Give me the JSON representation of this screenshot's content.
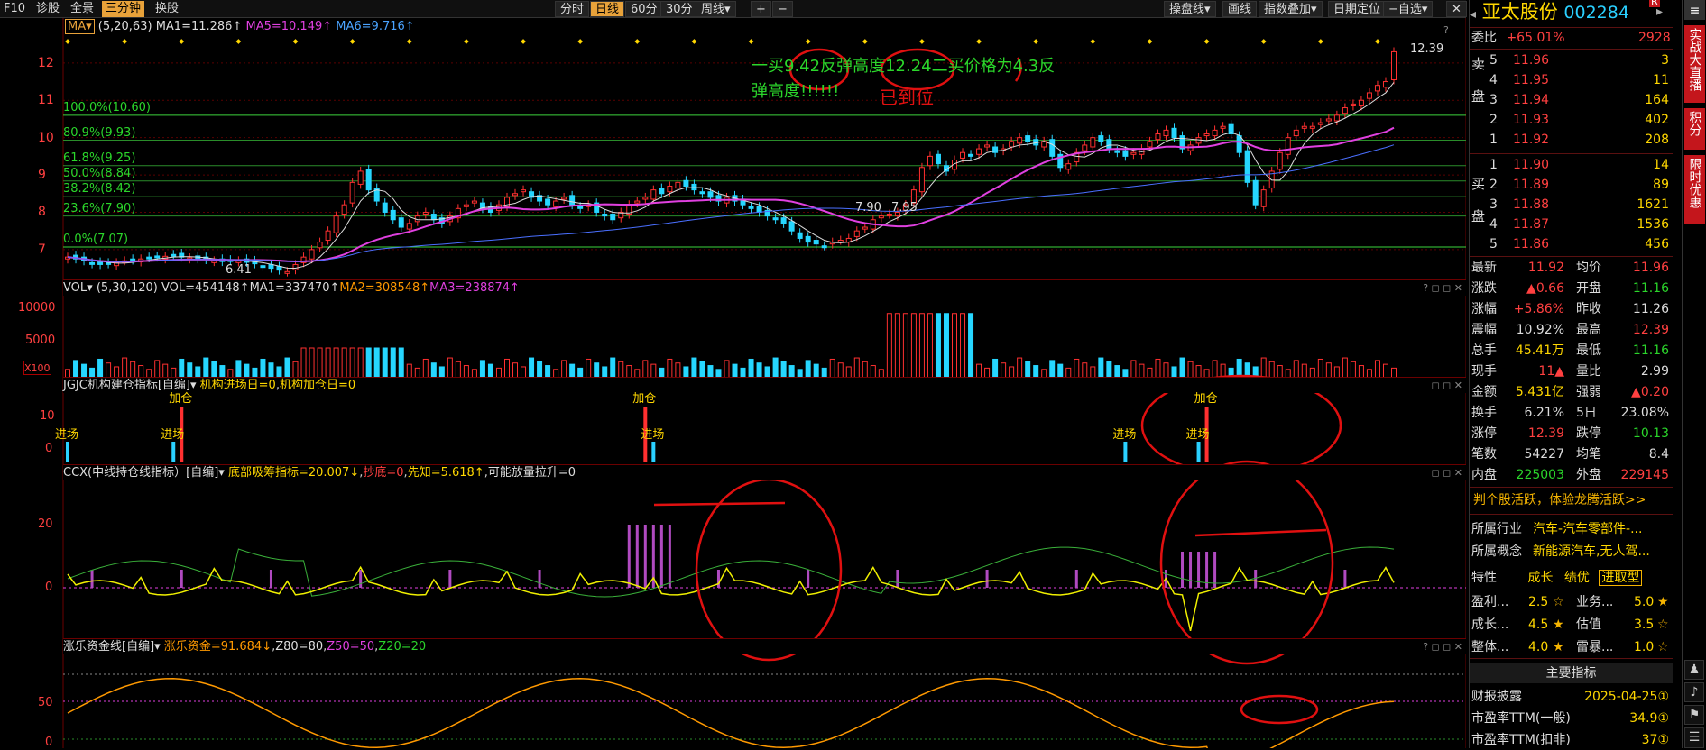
{
  "toolbar": {
    "f10": "F10",
    "diagnose": "诊股",
    "fullview": "全景",
    "three_min": "三分钟",
    "switch_stock": "换股",
    "periods": [
      "分时",
      "日线",
      "60分",
      "30分",
      "周线▾"
    ],
    "active_period": "日线",
    "plus": "+",
    "minus": "−",
    "ops": "操盘线▾",
    "draw": "画线",
    "overlay": "指数叠加▾",
    "date_locate": "日期定位",
    "watchlist": "−自选▾",
    "close": "✕"
  },
  "main_chart": {
    "ma_legend_type": "MA▾",
    "ma_params": "(5,20,63)",
    "ma1": "MA1=11.286↑",
    "ma5": "MA5=10.149↑",
    "ma6": "MA6=9.716↑",
    "fib": [
      "100.0%(10.60)",
      "80.9%(9.93)",
      "61.8%(9.25)",
      "50.0%(8.84)",
      "38.2%(8.42)",
      "23.6%(7.90)",
      "0.0%(7.07)"
    ],
    "y_ticks": [
      "12",
      "11",
      "10",
      "9",
      "8",
      "7"
    ],
    "low_label": "6.41",
    "high_label": "12.39",
    "mid_labels": [
      "7.90",
      "7.95"
    ],
    "annotation_line1": "一买9.42反弹高度12.24二买价格为4.3反",
    "annotation_line2": "弹高度!!!!!!",
    "annotation_red": "已到位",
    "question_mark": "?"
  },
  "vol_panel": {
    "label": "VOL▾",
    "params": "(5,30,120)",
    "vol": "VOL=454148↑",
    "ma1": "MA1=337470↑",
    "ma2": "MA2=308548↑",
    "ma3": "MA3=238874↑",
    "y_ticks": [
      "10000",
      "5000"
    ],
    "unit": "X100",
    "controls": "? ◻ ◻ ✕"
  },
  "jgjc_panel": {
    "label": "JGJC机构建仓指标[自编]▾",
    "value1": "机构进场日=0",
    "value2": "机构加仓日=0",
    "y_ticks": [
      "10",
      "0"
    ],
    "signals": [
      "进场",
      "进场",
      "加仓",
      "加仓",
      "进场",
      "进场",
      "进场",
      "加仓"
    ],
    "controls": "◻ ◻ ✕"
  },
  "ccx_panel": {
    "label": "CCX(中线持仓线指标）[自编]▾",
    "v1": "底部吸筹指标=20.007↓",
    "v2": "抄底=0",
    "v3": "先知=5.618↑",
    "v4": "可能放量拉升=0",
    "y_ticks": [
      "20",
      "0"
    ],
    "controls": "◻ ◻ ✕"
  },
  "zl_panel": {
    "label": "涨乐资金线[自编]▾",
    "v1": "涨乐资金=91.684↓",
    "v2": "Z80=80",
    "v3": "Z50=50",
    "v4": "Z20=20",
    "y_ticks": [
      "50",
      "0"
    ],
    "controls": "? ◻ ◻ ✕"
  },
  "chart_data": {
    "type": "candlestick",
    "ylim": [
      6.2,
      12.6
    ],
    "closes": [
      6.8,
      6.75,
      6.7,
      6.62,
      6.6,
      6.62,
      6.65,
      6.7,
      6.72,
      6.75,
      6.78,
      6.8,
      6.82,
      6.85,
      6.8,
      6.78,
      6.75,
      6.73,
      6.7,
      6.68,
      6.72,
      6.7,
      6.66,
      6.62,
      6.55,
      6.5,
      6.45,
      6.41,
      6.6,
      6.8,
      7.0,
      7.2,
      7.5,
      7.9,
      8.2,
      8.8,
      9.1,
      8.6,
      8.3,
      8.0,
      7.8,
      7.6,
      7.7,
      7.9,
      8.0,
      7.8,
      7.7,
      7.9,
      8.1,
      8.2,
      8.3,
      8.1,
      8.0,
      8.2,
      8.4,
      8.5,
      8.6,
      8.4,
      8.3,
      8.2,
      8.3,
      8.4,
      8.2,
      8.1,
      8.2,
      8.0,
      7.9,
      7.8,
      8.0,
      8.2,
      8.3,
      8.4,
      8.6,
      8.5,
      8.7,
      8.8,
      8.7,
      8.6,
      8.5,
      8.4,
      8.3,
      8.4,
      8.3,
      8.2,
      8.1,
      8.0,
      7.9,
      7.8,
      7.7,
      7.5,
      7.3,
      7.2,
      7.15,
      7.1,
      7.2,
      7.25,
      7.3,
      7.5,
      7.6,
      7.8,
      7.9,
      7.95,
      8.0,
      8.2,
      8.6,
      9.2,
      9.5,
      9.3,
      9.1,
      9.4,
      9.6,
      9.5,
      9.7,
      9.8,
      9.6,
      9.7,
      9.9,
      10.0,
      9.9,
      9.8,
      9.9,
      9.5,
      9.2,
      9.3,
      9.6,
      9.8,
      10.0,
      9.9,
      9.7,
      9.6,
      9.5,
      9.6,
      9.7,
      9.9,
      10.1,
      10.2,
      10.0,
      9.7,
      9.8,
      10.0,
      10.1,
      10.2,
      10.3,
      10.1,
      9.6,
      8.8,
      8.2,
      8.6,
      9.1,
      9.6,
      10.0,
      10.2,
      10.3,
      10.3,
      10.4,
      10.5,
      10.6,
      10.8,
      10.9,
      11.0,
      11.2,
      11.4,
      11.5,
      12.3
    ]
  },
  "quote": {
    "name": "亚太股份",
    "code": "002284",
    "badge": "R",
    "weibi_label": "委比",
    "weibi": "+65.01%",
    "weibi_num": "2928",
    "sell_side": "卖\n\n盘",
    "buy_side": "买\n\n盘",
    "asks": [
      {
        "lv": "5",
        "p": "11.96",
        "v": "3"
      },
      {
        "lv": "4",
        "p": "11.95",
        "v": "11"
      },
      {
        "lv": "3",
        "p": "11.94",
        "v": "164"
      },
      {
        "lv": "2",
        "p": "11.93",
        "v": "402"
      },
      {
        "lv": "1",
        "p": "11.92",
        "v": "208"
      }
    ],
    "bids": [
      {
        "lv": "1",
        "p": "11.90",
        "v": "14"
      },
      {
        "lv": "2",
        "p": "11.89",
        "v": "89"
      },
      {
        "lv": "3",
        "p": "11.88",
        "v": "1621"
      },
      {
        "lv": "4",
        "p": "11.87",
        "v": "1536"
      },
      {
        "lv": "5",
        "p": "11.86",
        "v": "456"
      }
    ],
    "stats": [
      {
        "l1": "最新",
        "v1": "11.92",
        "c1": "red",
        "l2": "均价",
        "v2": "11.96",
        "c2": "red"
      },
      {
        "l1": "涨跌",
        "v1": "▲0.66",
        "c1": "red",
        "l2": "开盘",
        "v2": "11.16",
        "c2": "grn"
      },
      {
        "l1": "涨幅",
        "v1": "+5.86%",
        "c1": "red",
        "l2": "昨收",
        "v2": "11.26",
        "c2": "wht"
      },
      {
        "l1": "震幅",
        "v1": "10.92%",
        "c1": "wht",
        "l2": "最高",
        "v2": "12.39",
        "c2": "red"
      },
      {
        "l1": "总手",
        "v1": "45.41万",
        "c1": "yel",
        "l2": "最低",
        "v2": "11.16",
        "c2": "grn"
      },
      {
        "l1": "现手",
        "v1": "11▲",
        "c1": "red",
        "l2": "量比",
        "v2": "2.99",
        "c2": "wht"
      },
      {
        "l1": "金额",
        "v1": "5.431亿",
        "c1": "yel",
        "l2": "强弱",
        "v2": "▲0.20",
        "c2": "red"
      },
      {
        "l1": "换手",
        "v1": "6.21%",
        "c1": "wht",
        "l2": "5日",
        "v2": "23.08%",
        "c2": "wht"
      },
      {
        "l1": "涨停",
        "v1": "12.39",
        "c1": "red",
        "l2": "跌停",
        "v2": "10.13",
        "c2": "grn"
      },
      {
        "l1": "笔数",
        "v1": "54227",
        "c1": "wht",
        "l2": "均笔",
        "v2": "8.4",
        "c2": "wht"
      },
      {
        "l1": "内盘",
        "v1": "225003",
        "c1": "grn",
        "l2": "外盘",
        "v2": "229145",
        "c2": "red"
      }
    ],
    "promo": "判个股活跃，体验龙腾活跃>>",
    "industry_label": "所属行业",
    "industry": "汽车-汽车零部件-...",
    "concept_label": "所属概念",
    "concept": "新能源汽车,无人驾...",
    "trait_label": "特性",
    "traits": [
      "成长",
      "绩优",
      "进取型"
    ],
    "ratings": [
      {
        "l1": "盈利...",
        "v1": "2.5",
        "s1": "☆",
        "l2": "业务...",
        "v2": "5.0",
        "s2": "★"
      },
      {
        "l1": "成长...",
        "v1": "4.5",
        "s1": "★",
        "l2": "估值",
        "v2": "3.5",
        "s2": "☆"
      },
      {
        "l1": "整体...",
        "v1": "4.0",
        "s1": "★",
        "l2": "雷暴...",
        "v2": "1.0",
        "s2": "☆"
      }
    ],
    "main_indicators_title": "主要指标",
    "indicators": [
      {
        "l": "财报披露",
        "v": "2025-04-25①"
      },
      {
        "l": "市盈率TTM(一般)",
        "v": "34.9①"
      },
      {
        "l": "市盈率TTM(扣非)",
        "v": "37①"
      }
    ]
  },
  "side_tabs": [
    "实战大直播",
    "积分",
    "限时优惠"
  ]
}
